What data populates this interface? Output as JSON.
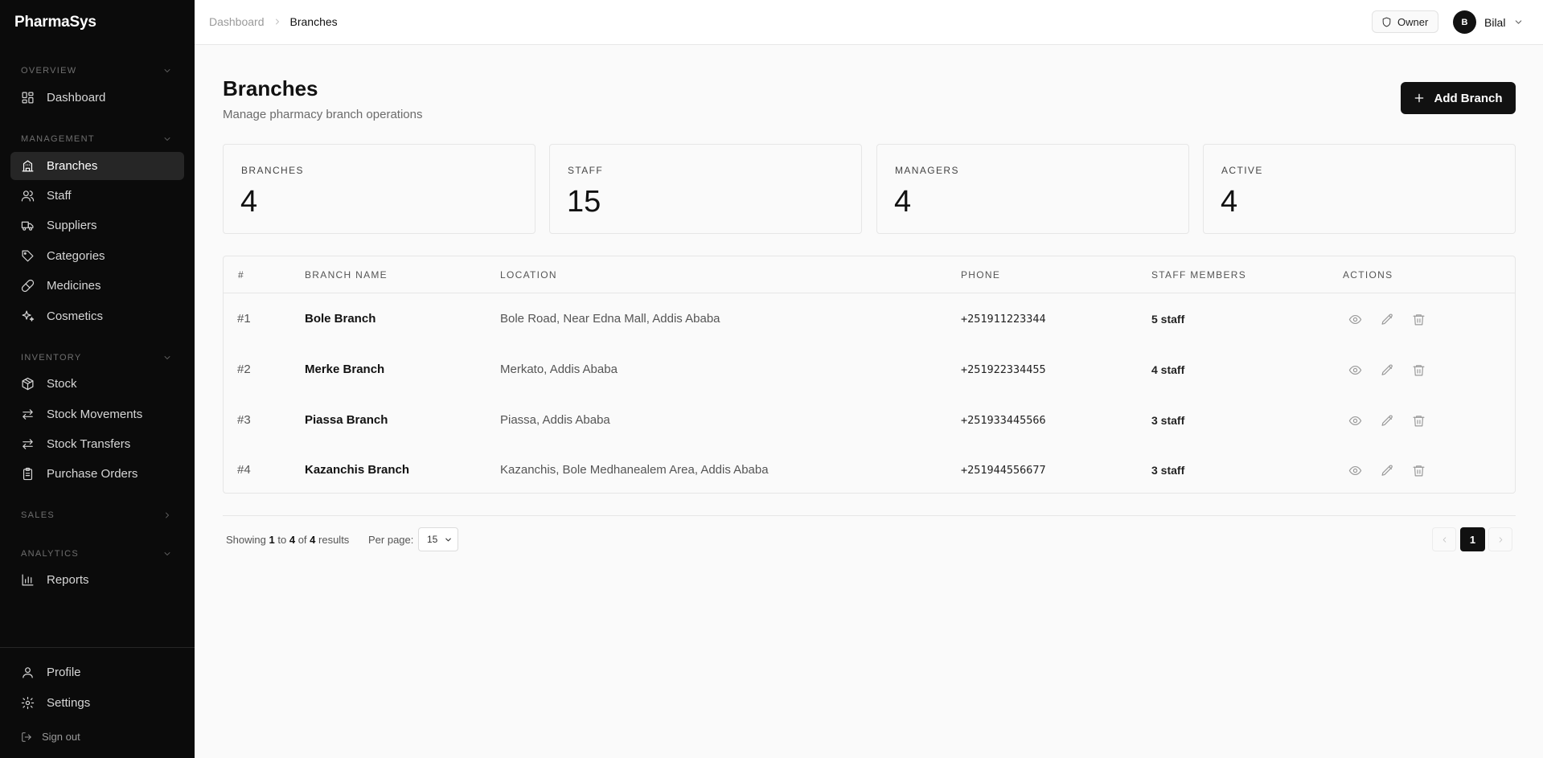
{
  "app": {
    "name": "PharmaSys"
  },
  "sidebar": {
    "sections": {
      "overview": "OVERVIEW",
      "management": "MANAGEMENT",
      "inventory": "INVENTORY",
      "sales": "SALES",
      "analytics": "ANALYTICS"
    },
    "items": {
      "dashboard": "Dashboard",
      "branches": "Branches",
      "staff": "Staff",
      "suppliers": "Suppliers",
      "categories": "Categories",
      "medicines": "Medicines",
      "cosmetics": "Cosmetics",
      "stock": "Stock",
      "stock_movements": "Stock Movements",
      "stock_transfers": "Stock Transfers",
      "purchase_orders": "Purchase Orders",
      "reports": "Reports"
    },
    "bottom": {
      "profile": "Profile",
      "settings": "Settings",
      "sign_out": "Sign out"
    }
  },
  "topbar": {
    "breadcrumb": [
      "Dashboard",
      "Branches"
    ],
    "role": "Owner",
    "user": {
      "initial": "B",
      "name": "Bilal"
    }
  },
  "page": {
    "title": "Branches",
    "subtitle": "Manage pharmacy branch operations",
    "add_button": "Add Branch"
  },
  "stats": [
    {
      "label": "BRANCHES",
      "value": "4"
    },
    {
      "label": "STAFF",
      "value": "15"
    },
    {
      "label": "MANAGERS",
      "value": "4"
    },
    {
      "label": "ACTIVE",
      "value": "4"
    }
  ],
  "table": {
    "headers": [
      "#",
      "BRANCH NAME",
      "LOCATION",
      "PHONE",
      "STAFF MEMBERS",
      "ACTIONS"
    ],
    "rows": [
      {
        "num": "#1",
        "name": "Bole Branch",
        "location": "Bole Road, Near Edna Mall, Addis Ababa",
        "phone": "+251911223344",
        "staff": "5 staff"
      },
      {
        "num": "#2",
        "name": "Merke Branch",
        "location": "Merkato, Addis Ababa",
        "phone": "+251922334455",
        "staff": "4 staff"
      },
      {
        "num": "#3",
        "name": "Piassa Branch",
        "location": "Piassa, Addis Ababa",
        "phone": "+251933445566",
        "staff": "3 staff"
      },
      {
        "num": "#4",
        "name": "Kazanchis Branch",
        "location": "Kazanchis, Bole Medhanealem Area, Addis Ababa",
        "phone": "+251944556677",
        "staff": "3 staff"
      }
    ]
  },
  "pagination": {
    "showing_prefix": "Showing",
    "from": "1",
    "to_word": "to",
    "to": "4",
    "of_word": "of",
    "total": "4",
    "results_word": "results",
    "per_page_label": "Per page:",
    "per_page_value": "15",
    "current_page": "1"
  }
}
